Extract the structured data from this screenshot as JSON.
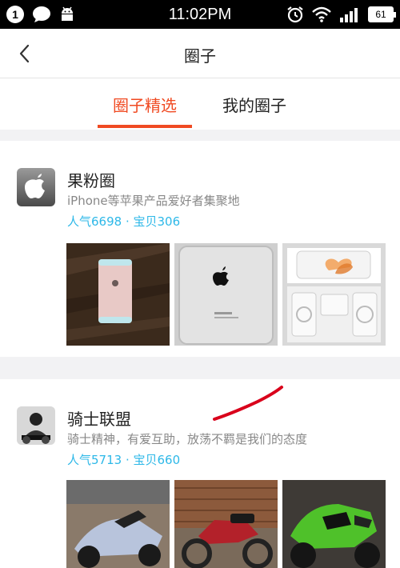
{
  "status_bar": {
    "notification_count": "1",
    "time": "11:02PM",
    "battery": "61"
  },
  "nav": {
    "title": "圈子",
    "back_icon": "chevron-left-icon"
  },
  "tabs": [
    {
      "label": "圈子精选",
      "active": true
    },
    {
      "label": "我的圈子",
      "active": false
    }
  ],
  "colors": {
    "accent": "#f04a22",
    "stats": "#2db8e8"
  },
  "circles": [
    {
      "name": "果粉圈",
      "description": "iPhone等苹果产品爱好者集聚地",
      "stats": "人气6698 · 宝贝306"
    },
    {
      "name": "骑士联盟",
      "description": "骑士精神，有爱互助，放荡不羁是我们的态度",
      "stats": "人气5713 · 宝贝660"
    }
  ]
}
